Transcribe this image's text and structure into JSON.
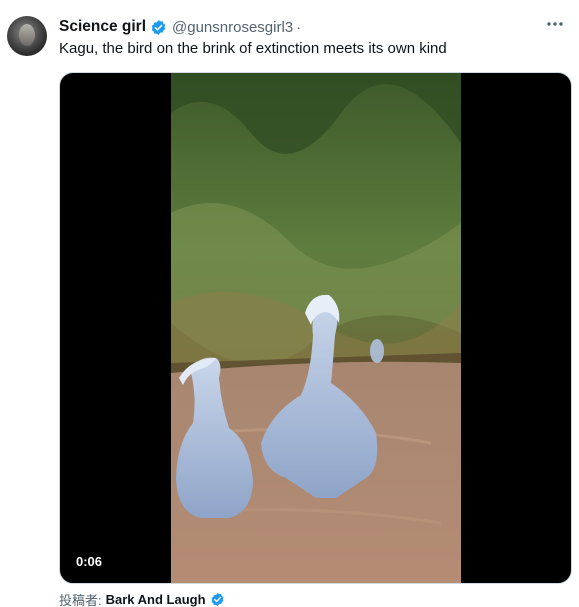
{
  "tweet": {
    "author_name": "Science girl",
    "handle": "@gunsnrosesgirl3",
    "separator": "·",
    "text": "Kagu, the bird on the brink of extinction meets its own kind",
    "verified_icon": "verified-badge-icon",
    "more_icon": "more-options-icon"
  },
  "media": {
    "duration": "0:06"
  },
  "attribution": {
    "label": "投稿者:",
    "author": "Bark And Laugh"
  },
  "colors": {
    "verified_blue": "#1d9bf0",
    "text_primary": "#0f1419",
    "text_secondary": "#536471"
  }
}
